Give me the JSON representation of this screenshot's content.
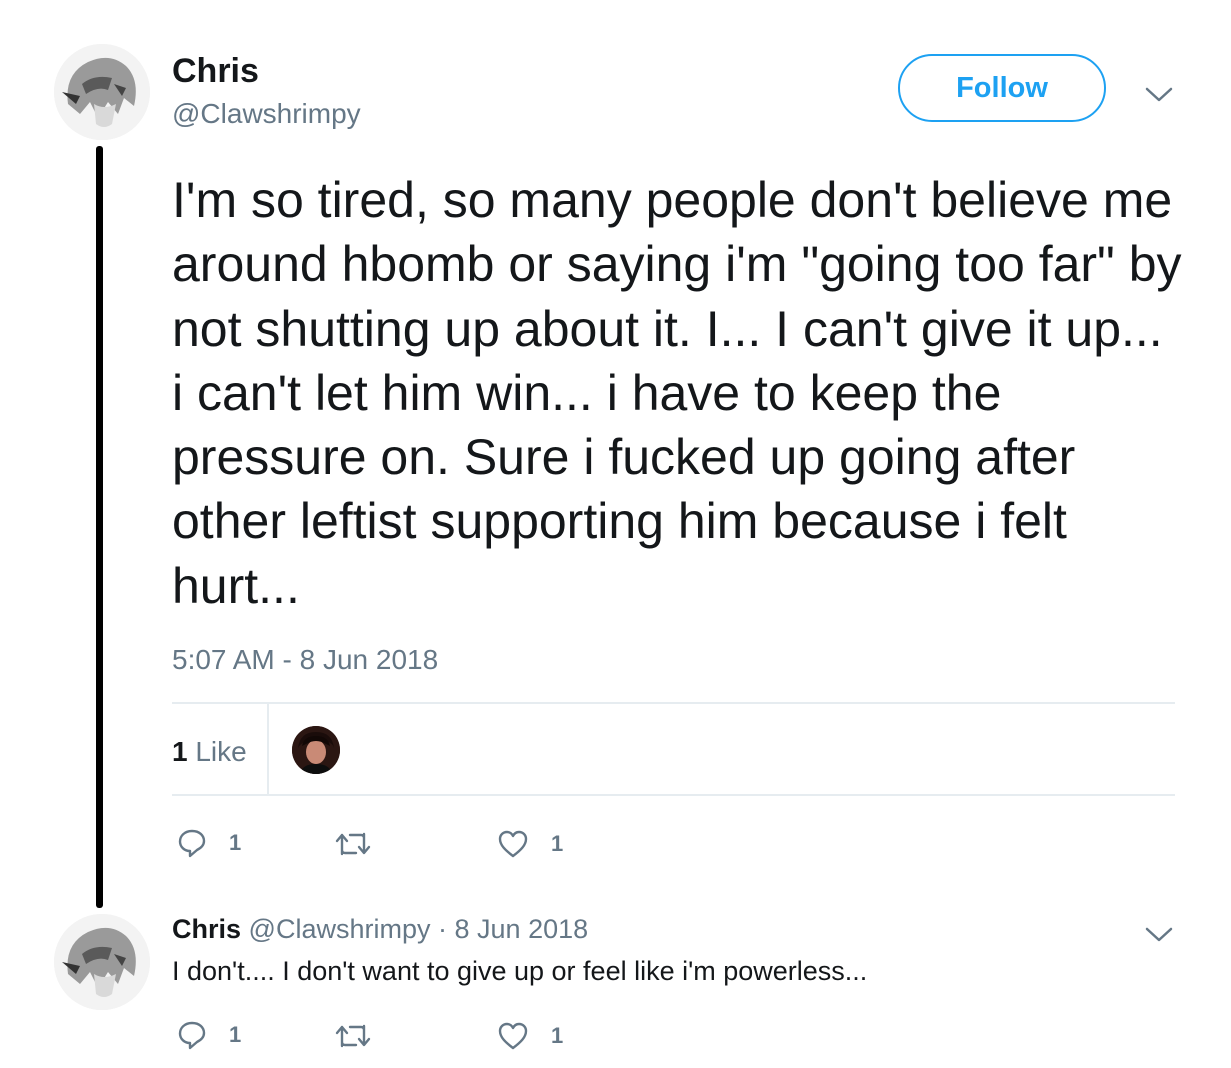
{
  "tweet": {
    "author_name": "Chris",
    "author_handle": "@Clawshrimpy",
    "follow_label": "Follow",
    "text": "I'm so tired, so many people don't believe me around hbomb or saying i'm \"going too far\" by not shutting up about it. I... I can't give it up... i can't let him win... i have to keep the pressure on. Sure i fucked up going after other leftist supporting him because i felt hurt...",
    "timestamp": "5:07 AM - 8 Jun 2018",
    "likes_number": "1",
    "likes_label": "Like",
    "actions": {
      "replies": "1",
      "retweets": "",
      "likes": "1"
    }
  },
  "reply": {
    "author_name": "Chris",
    "author_handle": "@Clawshrimpy",
    "separator": "·",
    "date": "8 Jun 2018",
    "text": "I don't.... I don't want to give up or feel like i'm powerless...",
    "actions": {
      "replies": "1",
      "retweets": "",
      "likes": "1"
    }
  },
  "icons": {
    "reply": "reply-bubble-icon",
    "retweet": "retweet-icon",
    "like": "heart-icon",
    "menu": "chevron-down-icon"
  },
  "colors": {
    "accent": "#1da1f2",
    "text": "#14171a",
    "secondary": "#657786",
    "border": "#e6ecf0"
  }
}
